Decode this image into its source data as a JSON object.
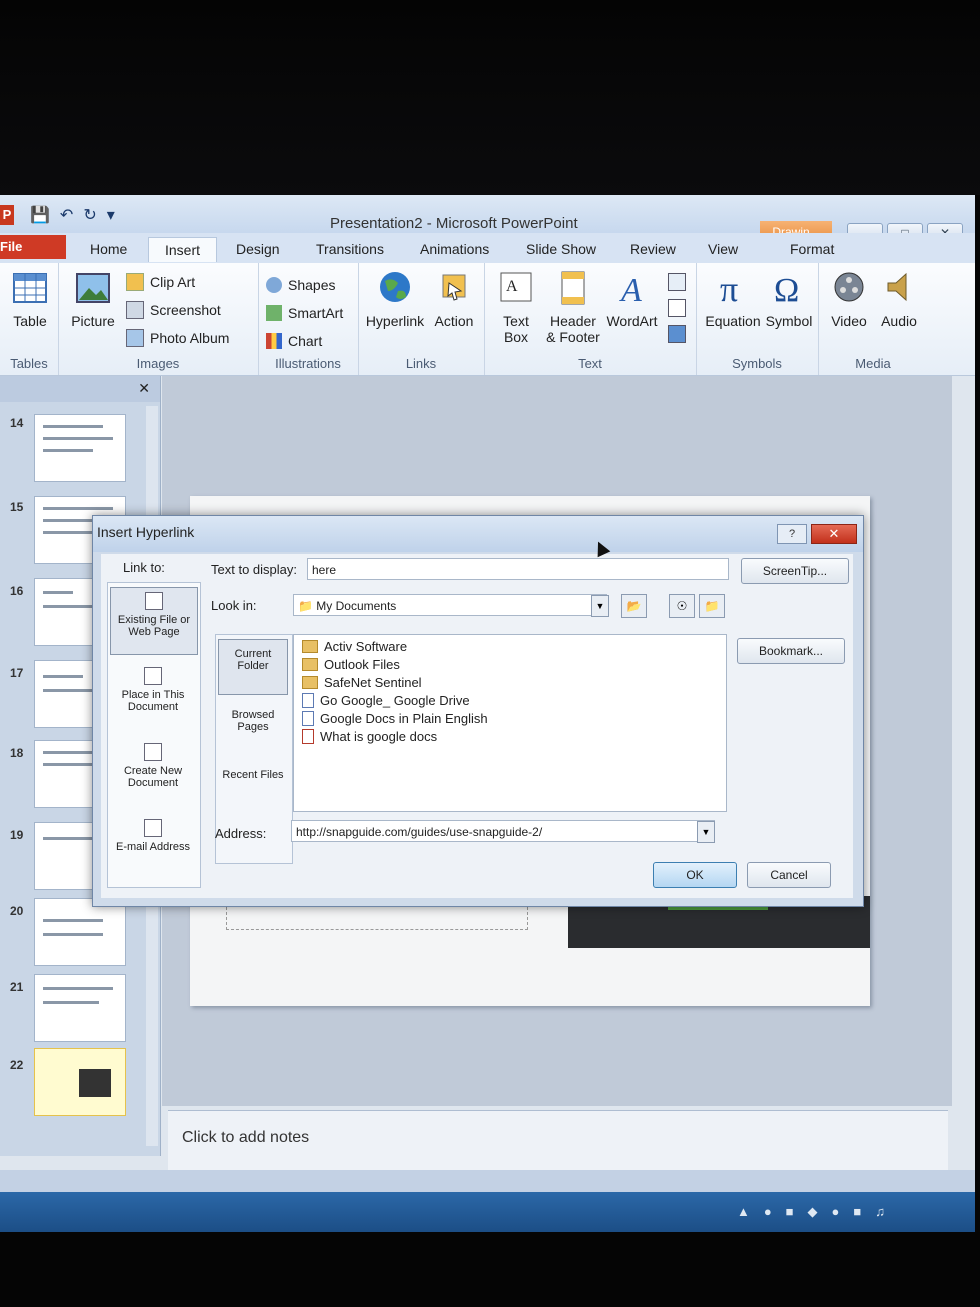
{
  "app": {
    "title": "Presentation2 - Microsoft PowerPoint",
    "logo": "P",
    "contextual_tab": "Drawin...",
    "window_buttons": [
      "—",
      "□",
      "✕"
    ]
  },
  "tabs": [
    "File",
    "Home",
    "Insert",
    "Design",
    "Transitions",
    "Animations",
    "Slide Show",
    "Review",
    "View",
    "Format"
  ],
  "active_tab": "Insert",
  "ribbon": {
    "tables": {
      "label": "Tables",
      "table": "Table"
    },
    "images": {
      "label": "Images",
      "picture": "Picture",
      "clip_art": "Clip Art",
      "screenshot": "Screenshot",
      "photo_album": "Photo Album"
    },
    "illustrations": {
      "label": "Illustrations",
      "shapes": "Shapes",
      "smartart": "SmartArt",
      "chart": "Chart"
    },
    "links": {
      "label": "Links",
      "hyperlink": "Hyperlink",
      "action": "Action"
    },
    "text": {
      "label": "Text",
      "text_box_1": "Text",
      "text_box_2": "Box",
      "header_1": "Header",
      "header_2": "& Footer",
      "wordart": "WordArt"
    },
    "symbols": {
      "label": "Symbols",
      "equation": "Equation",
      "symbol": "Symbol"
    },
    "media": {
      "label": "Media",
      "video": "Video",
      "audio": "Audio"
    }
  },
  "slides": [
    "14",
    "15",
    "16",
    "17",
    "18",
    "19",
    "20",
    "21",
    "22"
  ],
  "notes_placeholder": "Click to add notes",
  "dialog": {
    "title": "Insert Hyperlink",
    "link_to_label": "Link to:",
    "link_to_options": [
      "Existing File or Web Page",
      "Place in This Document",
      "Create New Document",
      "E-mail Address"
    ],
    "text_to_display_label": "Text to display:",
    "text_to_display_value": "here",
    "screentip_button": "ScreenTip...",
    "look_in_label": "Look in:",
    "look_in_value": "My Documents",
    "look_in_options": [
      "Current Folder",
      "Browsed Pages",
      "Recent Files"
    ],
    "files": [
      {
        "name": "Activ Software",
        "type": "folder"
      },
      {
        "name": "Outlook Files",
        "type": "folder"
      },
      {
        "name": "SafeNet Sentinel",
        "type": "folder"
      },
      {
        "name": "Go Google_ Google Drive",
        "type": "doc"
      },
      {
        "name": "Google Docs in Plain English",
        "type": "doc"
      },
      {
        "name": "What is google docs",
        "type": "pdf"
      }
    ],
    "bookmark_button": "Bookmark...",
    "address_label": "Address:",
    "address_value": "http://snapguide.com/guides/use-snapguide-2/",
    "ok_button": "OK",
    "cancel_button": "Cancel",
    "help_button": "?",
    "close_button": "✕"
  },
  "colors": {
    "file_tab": "#cf3a25",
    "contextual_tab": "#e88c3c",
    "taskbar": "#2b68a8"
  }
}
